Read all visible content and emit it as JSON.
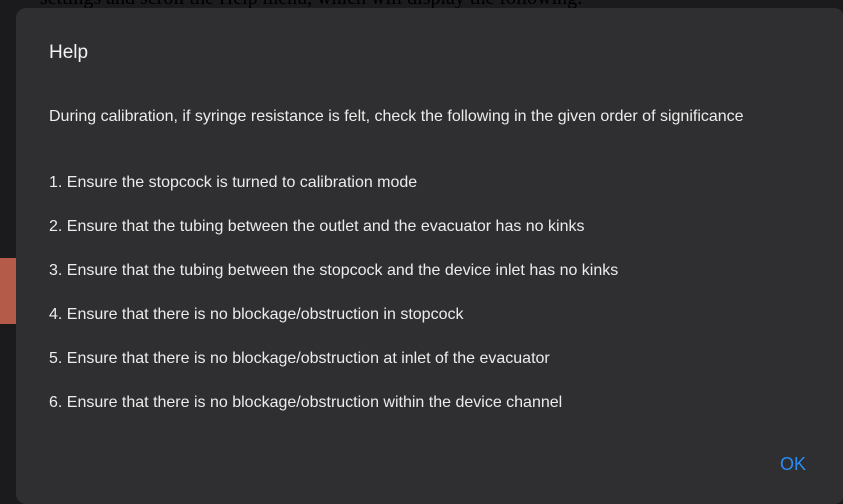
{
  "background_caption": "settings and scroll the Help menu, which will display the following:",
  "dialog": {
    "title": "Help",
    "intro": "During calibration, if syringe resistance is felt, check the following in the given order of significance",
    "steps": [
      "1. Ensure the stopcock is turned to calibration mode",
      "2. Ensure that the tubing between the outlet and the evacuator has no kinks",
      "3. Ensure that the tubing between the stopcock and the device inlet has no kinks",
      "4. Ensure that there is no blockage/obstruction in stopcock",
      "5. Ensure that there is no blockage/obstruction at inlet of the evacuator",
      "6. Ensure that there is no blockage/obstruction within the device channel"
    ],
    "ok_label": "OK"
  },
  "colors": {
    "dialog_background": "#2f2f31",
    "text": "#ececec",
    "accent": "#2a8df5"
  }
}
